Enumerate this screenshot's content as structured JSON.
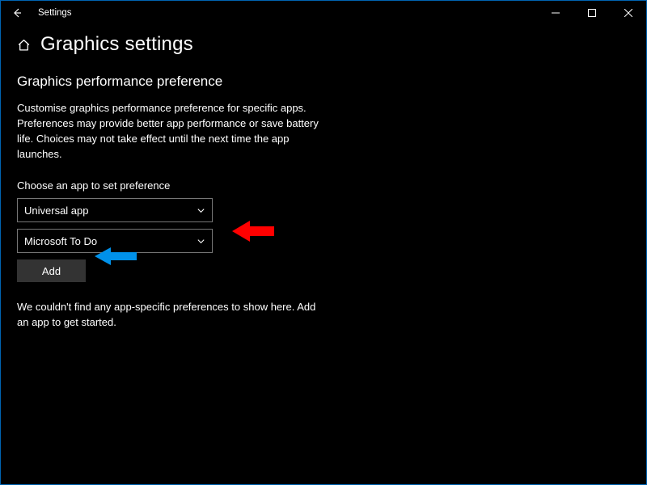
{
  "window": {
    "title": "Settings"
  },
  "header": {
    "page_title": "Graphics settings"
  },
  "section": {
    "title": "Graphics performance preference",
    "description": "Customise graphics performance preference for specific apps. Preferences may provide better app performance or save battery life. Choices may not take effect until the next time the app launches."
  },
  "chooser": {
    "label": "Choose an app to set preference",
    "type_dropdown": "Universal app",
    "app_dropdown": "Microsoft To Do",
    "add_button": "Add"
  },
  "empty_state": "We couldn't find any app-specific preferences to show here. Add an app to get started.",
  "annotations": {
    "red_arrow_color": "#ff0000",
    "blue_arrow_color": "#0091ea"
  }
}
